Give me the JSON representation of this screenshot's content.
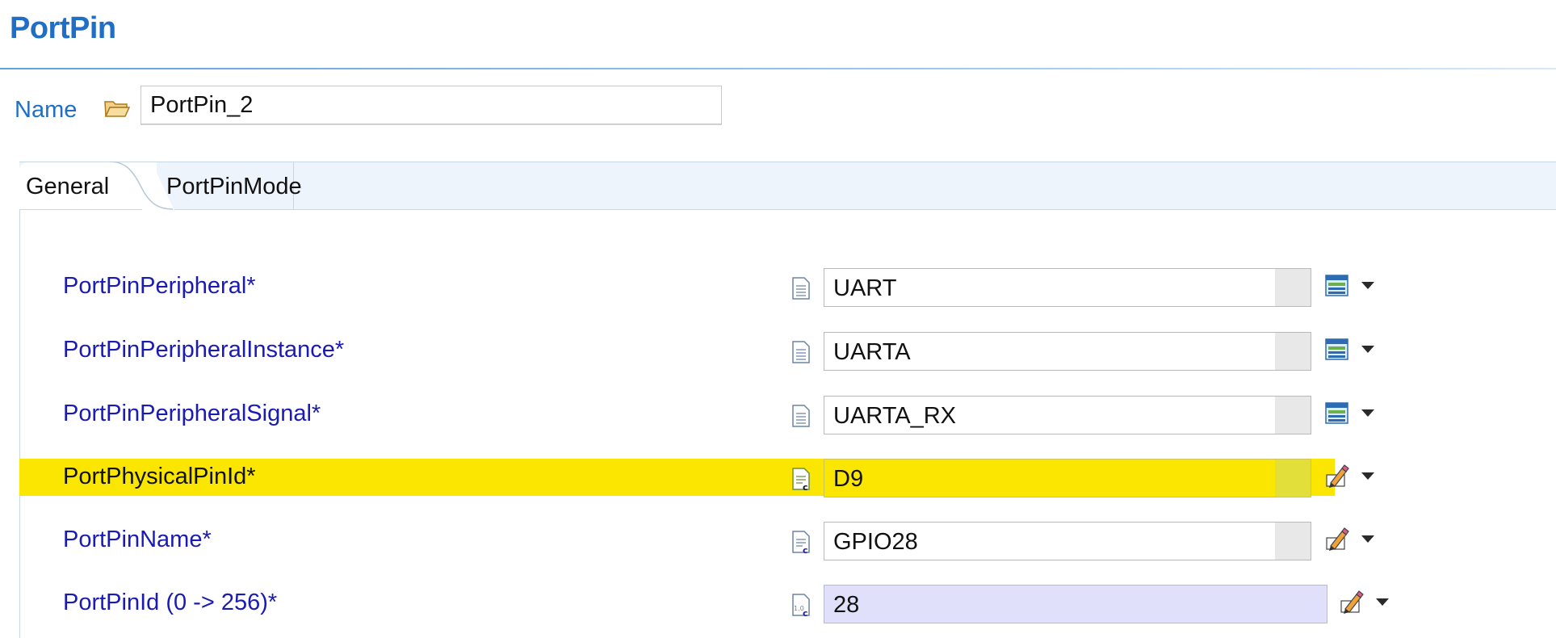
{
  "header": {
    "title": "PortPin"
  },
  "name_field": {
    "label": "Name",
    "value": "PortPin_2",
    "icon": "folder-open-icon"
  },
  "tabs": [
    {
      "label": "General",
      "active": true
    },
    {
      "label": "PortPinMode",
      "active": false
    }
  ],
  "rows": [
    {
      "label": "PortPinPeripheral*",
      "value": "UART",
      "value_icon": "document-icon",
      "action_icon": "list-select-icon",
      "highlighted": false
    },
    {
      "label": "PortPinPeripheralInstance*",
      "value": "UARTA",
      "value_icon": "document-icon",
      "action_icon": "list-select-icon",
      "highlighted": false
    },
    {
      "label": "PortPinPeripheralSignal*",
      "value": "UARTA_RX",
      "value_icon": "document-icon",
      "action_icon": "list-select-icon",
      "highlighted": false
    },
    {
      "label": "PortPhysicalPinId*",
      "value": "D9",
      "value_icon": "document-c-icon",
      "action_icon": "edit-pencil-icon",
      "highlighted": true
    },
    {
      "label": "PortPinName*",
      "value": "GPIO28",
      "value_icon": "document-c-icon",
      "action_icon": "edit-pencil-icon",
      "highlighted": false
    },
    {
      "label": "PortPinId (0 -> 256)*",
      "value": "28",
      "value_icon": "document-numeric-c-icon",
      "action_icon": "edit-pencil-icon",
      "highlighted": false
    }
  ],
  "colors": {
    "accent": "#1f6fc6",
    "label": "#1a1ab4",
    "highlight": "#fae600",
    "numeric_field": "#e0e0fa"
  }
}
